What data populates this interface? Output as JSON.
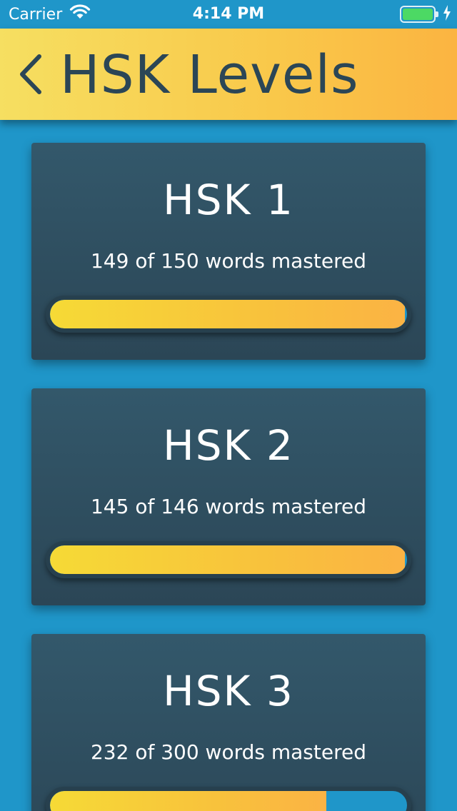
{
  "status_bar": {
    "carrier": "Carrier",
    "time": "4:14 PM"
  },
  "header": {
    "title": "HSK Levels"
  },
  "levels": [
    {
      "title": "HSK 1",
      "subtitle": "149 of 150 words mastered",
      "mastered": 149,
      "total": 150
    },
    {
      "title": "HSK 2",
      "subtitle": "145 of 146 words mastered",
      "mastered": 145,
      "total": 146
    },
    {
      "title": "HSK 3",
      "subtitle": "232 of 300 words mastered",
      "mastered": 232,
      "total": 300
    }
  ],
  "colors": {
    "background": "#1f96c9",
    "header_gradient_start": "#f6df61",
    "header_gradient_end": "#fbb441",
    "card": "#2b4656",
    "progress_fill": "#f8c23c",
    "title_text": "#2b4656"
  },
  "icons": [
    "wifi-icon",
    "battery-icon",
    "charging-bolt-icon",
    "chevron-left-icon"
  ]
}
